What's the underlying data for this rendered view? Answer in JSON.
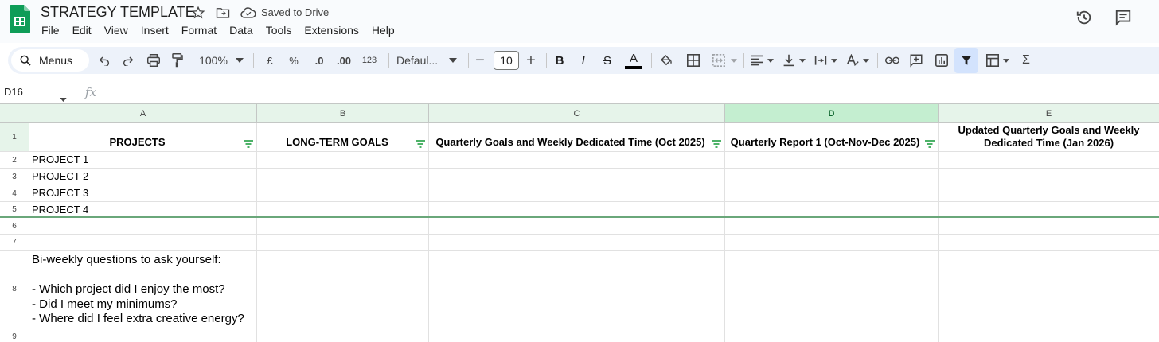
{
  "app": {
    "title": "STRATEGY TEMPLATE",
    "saved_status": "Saved to Drive",
    "icons": {
      "star": "star-icon",
      "move": "move-to-folder-icon",
      "cloud": "cloud-saved-icon",
      "history": "version-history-icon",
      "comments": "comments-icon",
      "logo": "google-sheets-logo"
    },
    "brand_color": "#0f9d58"
  },
  "menu": [
    "File",
    "Edit",
    "View",
    "Insert",
    "Format",
    "Data",
    "Tools",
    "Extensions",
    "Help"
  ],
  "toolbar": {
    "search_label": "Menus",
    "zoom": "100%",
    "currency": "£",
    "percent": "%",
    "decrease_decimal": ".0",
    "increase_decimal": ".00",
    "number_format": "123",
    "font": "Defaul...",
    "font_size": "10",
    "minus": "−",
    "plus": "+",
    "bold": "B",
    "italic": "I",
    "strike": "S",
    "text_color": "A",
    "sum": "Σ",
    "active_color": "#d3e3fd"
  },
  "formula_bar": {
    "name_box": "D16",
    "fx": "fx",
    "value": ""
  },
  "grid": {
    "columns": [
      "A",
      "B",
      "C",
      "D",
      "E"
    ],
    "selected_column": "D",
    "rows": [
      "1",
      "2",
      "3",
      "4",
      "5",
      "6",
      "7",
      "8",
      "9"
    ],
    "headers": [
      "PROJECTS",
      "LONG-TERM GOALS",
      "Quarterly Goals and Weekly Dedicated Time (Oct 2025)",
      "Quarterly Report 1 (Oct-Nov-Dec 2025)",
      "Updated Quarterly Goals and Weekly Dedicated Time (Jan 2026)"
    ],
    "projects": [
      "PROJECT 1",
      "PROJECT 2",
      "PROJECT 3",
      "PROJECT 4"
    ],
    "notes": "Bi-weekly questions to ask yourself:\n\n- Which project did I enjoy the most?\n- Did I meet my minimums?\n- Where did I feel extra creative energy?",
    "filter_color": "#34a853",
    "header_bg": "#e6f4ea"
  }
}
